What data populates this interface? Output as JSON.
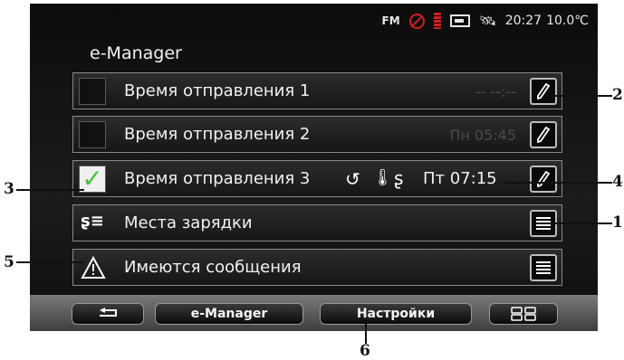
{
  "status": {
    "fm": "FM",
    "time": "20:27",
    "temperature": "10.0℃"
  },
  "title": "e-Manager",
  "rows": [
    {
      "label": "Время отправления 1",
      "time": "-- --:--"
    },
    {
      "label": "Время отправления 2",
      "time": "Пн 05:45"
    },
    {
      "label": "Время отправления 3",
      "time": "Пт 07:15"
    },
    {
      "label": "Места зарядки"
    },
    {
      "label": "Имеются сообщения"
    }
  ],
  "bottom": {
    "emanager": "e-Manager",
    "settings": "Настройки"
  },
  "callouts": [
    "1",
    "2",
    "3",
    "4",
    "5",
    "6"
  ]
}
